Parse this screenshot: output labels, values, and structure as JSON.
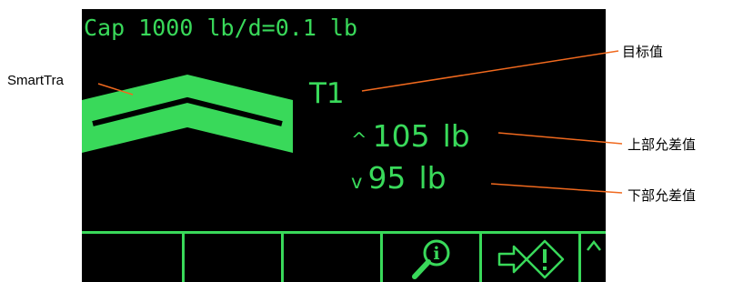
{
  "screen": {
    "capacity_line": "Cap 1000 lb/d=0.1 lb",
    "target_id": "T1",
    "upper_tolerance": {
      "symbol": "^",
      "value": "105",
      "unit": "lb"
    },
    "lower_tolerance": {
      "symbol": "v",
      "value": "95",
      "unit": "lb"
    },
    "softkeys": [
      {
        "icon": ""
      },
      {
        "icon": ""
      },
      {
        "icon": ""
      },
      {
        "icon": "info-magnifier-icon"
      },
      {
        "icon": "target-transfer-icon"
      },
      {
        "icon": "scroll-up-icon"
      }
    ],
    "display_color": "#39d95a"
  },
  "callouts": {
    "smarttrac": "SmartTra",
    "target_value": "目标值",
    "upper_tolerance": "上部允差值",
    "lower_tolerance": "下部允差值",
    "leader_color": "#f0691e"
  }
}
